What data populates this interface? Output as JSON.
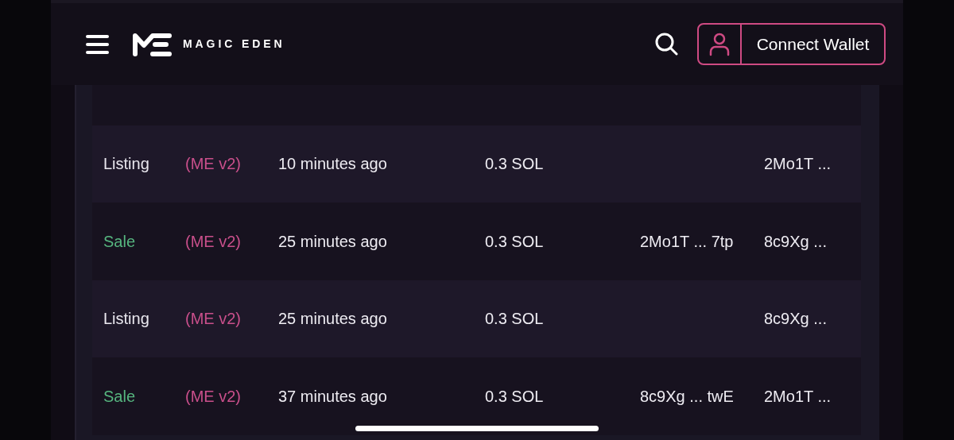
{
  "header": {
    "brand": "MAGIC EDEN",
    "connect_button": "Connect Wallet"
  },
  "activity": {
    "rows": [
      {
        "kind": "sale"
      },
      {
        "kind": "listing",
        "type": "Listing",
        "marketplace": "(ME v2)",
        "time": "10 minutes ago",
        "price": "0.3 SOL",
        "seller": "2Mo1T ..."
      },
      {
        "kind": "sale",
        "type": "Sale",
        "marketplace": "(ME v2)",
        "time": "25 minutes ago",
        "price": "0.3 SOL",
        "buyer": "2Mo1T ... 7tp",
        "seller": "8c9Xg ..."
      },
      {
        "kind": "listing",
        "type": "Listing",
        "marketplace": "(ME v2)",
        "time": "25 minutes ago",
        "price": "0.3 SOL",
        "seller": "8c9Xg ..."
      },
      {
        "kind": "sale",
        "type": "Sale",
        "marketplace": "(ME v2)",
        "time": "37 minutes ago",
        "price": "0.3 SOL",
        "buyer": "8c9Xg ... twE",
        "seller": "2Mo1T ..."
      }
    ]
  }
}
